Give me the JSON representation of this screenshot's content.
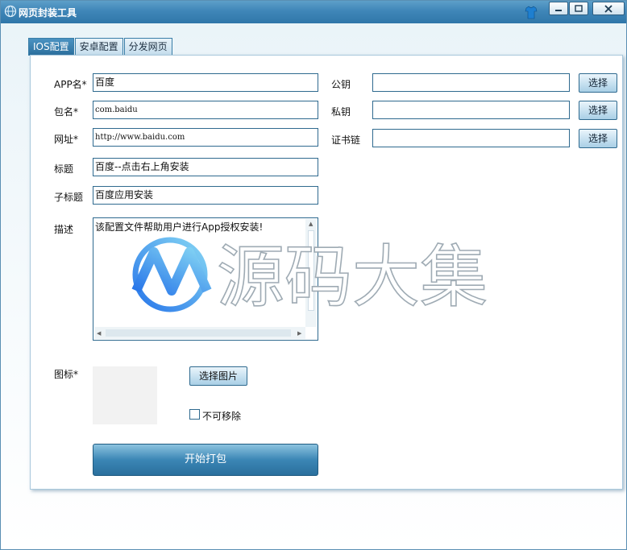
{
  "window": {
    "title": "网页封装工具",
    "controls": [
      "minimize",
      "maximize",
      "close"
    ]
  },
  "tabs": [
    {
      "label": "IOS配置",
      "active": true
    },
    {
      "label": "安卓配置",
      "active": false
    },
    {
      "label": "分发网页",
      "active": false
    }
  ],
  "form": {
    "app_name": {
      "label": "APP名*",
      "value": "百度"
    },
    "package": {
      "label": "包名*",
      "value": "com.baidu"
    },
    "url": {
      "label": "网址*",
      "value": "http://www.baidu.com"
    },
    "title": {
      "label": "标题",
      "value": "百度--点击右上角安装"
    },
    "subtitle": {
      "label": "子标题",
      "value": "百度应用安装"
    },
    "description": {
      "label": "描述",
      "value": "该配置文件帮助用户进行App授权安装!"
    },
    "public_key": {
      "label": "公钥",
      "value": "",
      "button": "选择"
    },
    "private_key": {
      "label": "私钥",
      "value": "",
      "button": "选择"
    },
    "cert_chain": {
      "label": "证书链",
      "value": "",
      "button": "选择"
    },
    "icon": {
      "label": "图标*",
      "button": "选择图片"
    },
    "non_removable": {
      "label": "不可移除",
      "checked": false
    },
    "pack_button": "开始打包"
  },
  "watermark": {
    "text": "源码大集"
  },
  "colors": {
    "titlebar": "#3f86b8",
    "accent": "#2f6a8f",
    "button_light": "#a9cfe6"
  }
}
